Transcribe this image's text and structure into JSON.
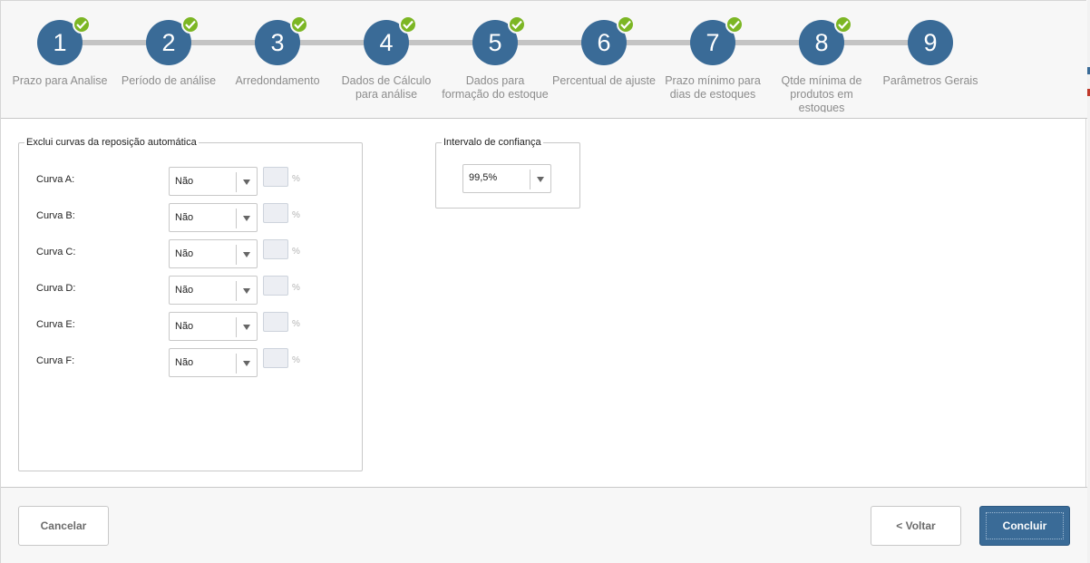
{
  "wizard": {
    "steps": [
      {
        "number": "1",
        "label": "Prazo para Analise",
        "done": true
      },
      {
        "number": "2",
        "label": "Período de análise",
        "done": true
      },
      {
        "number": "3",
        "label": "Arredondamento",
        "done": true
      },
      {
        "number": "4",
        "label": "Dados de Cálculo para análise",
        "done": true
      },
      {
        "number": "5",
        "label": "Dados para formação do estoque",
        "done": true
      },
      {
        "number": "6",
        "label": "Percentual de ajuste",
        "done": true
      },
      {
        "number": "7",
        "label": "Prazo mínimo para dias de estoques",
        "done": true
      },
      {
        "number": "8",
        "label": "Qtde mínima de produtos em estoques",
        "done": true
      },
      {
        "number": "9",
        "label": "Parâmetros Gerais",
        "done": false
      }
    ]
  },
  "curvas": {
    "legend": "Exclui curvas da reposição automática",
    "pct_symbol": "%",
    "rows": [
      {
        "label": "Curva A:",
        "value": "Não"
      },
      {
        "label": "Curva B:",
        "value": "Não"
      },
      {
        "label": "Curva C:",
        "value": "Não"
      },
      {
        "label": "Curva D:",
        "value": "Não"
      },
      {
        "label": "Curva E:",
        "value": "Não"
      },
      {
        "label": "Curva F:",
        "value": "Não"
      }
    ]
  },
  "intervalo": {
    "legend": "Intervalo de confiança",
    "value": "99,5%"
  },
  "footer": {
    "cancel_label": "Cancelar",
    "back_label": "< Voltar",
    "finish_label": "Concluir"
  },
  "colors": {
    "step_circle": "#3a6b97",
    "check_badge": "#7cb624",
    "primary_button": "#3a6b97"
  }
}
